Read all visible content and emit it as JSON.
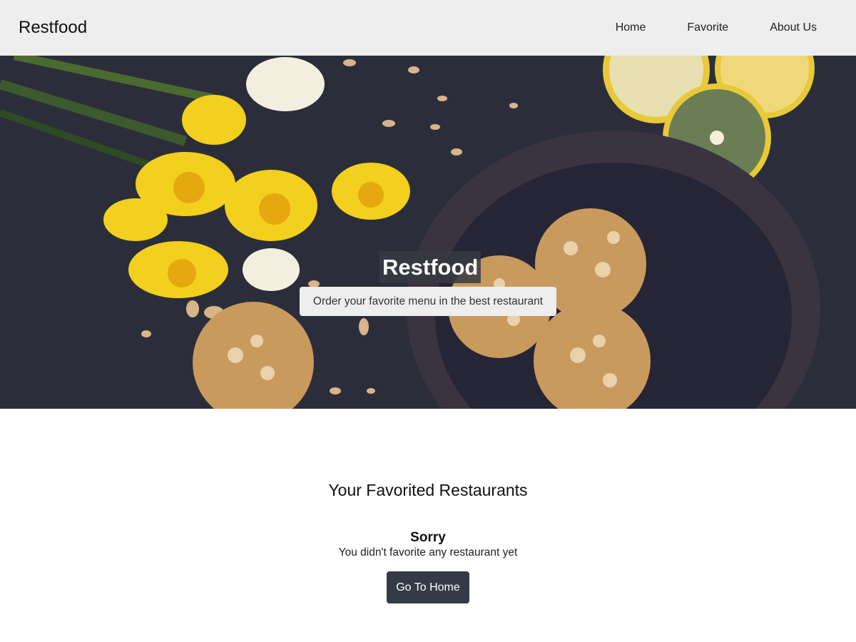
{
  "header": {
    "brand": "Restfood",
    "nav": [
      {
        "label": "Home"
      },
      {
        "label": "Favorite"
      },
      {
        "label": "About Us"
      }
    ]
  },
  "hero": {
    "title": "Restfood",
    "subtitle": "Order your favorite menu in the best restaurant"
  },
  "favorites": {
    "title": "Your Favorited Restaurants",
    "empty_title": "Sorry",
    "empty_message": "You didn't favorite any restaurant yet",
    "home_button": "Go To Home"
  },
  "colors": {
    "header_bg": "#eeeeee",
    "button_bg": "#343a46",
    "hero_bg": "#2a2d38"
  }
}
